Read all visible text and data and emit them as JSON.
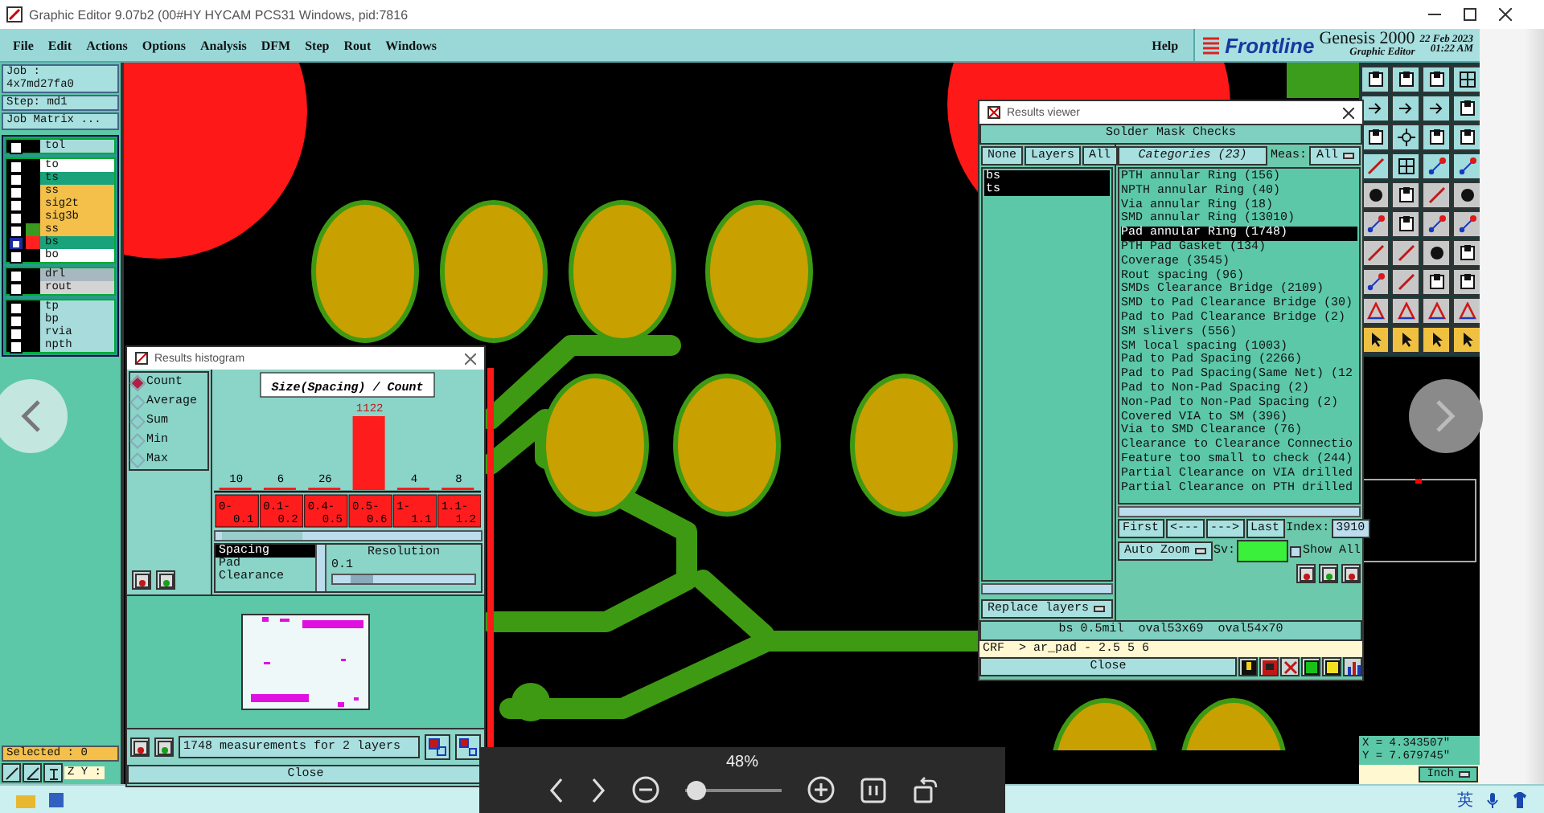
{
  "window": {
    "title": "Graphic Editor 9.07b2 (00#HY HYCAM PCS31  Windows, pid:7816"
  },
  "menu": [
    "File",
    "Edit",
    "Actions",
    "Options",
    "Analysis",
    "DFM",
    "Step",
    "Rout",
    "Windows"
  ],
  "help": "Help",
  "brand": {
    "logo": "Frontline",
    "product": "Genesis 2000",
    "subtitle": "Graphic Editor",
    "date": "22 Feb 2023",
    "time": "01:22 AM"
  },
  "job": {
    "job": "Job : 4x7md27fa0",
    "step": "Step: md1",
    "matrix": "Job Matrix ..."
  },
  "layer_groups": [
    [
      {
        "name": "tol",
        "color": "#a8dcdc",
        "affected": false
      }
    ],
    [
      {
        "name": "to",
        "color": "#ffffff",
        "affected": false
      },
      {
        "name": "ts",
        "color": "#1aa37a",
        "affected": false
      },
      {
        "name": "ss",
        "color": "#f4c04a",
        "affected": false
      },
      {
        "name": "sig2t",
        "color": "#f4c04a",
        "affected": false
      },
      {
        "name": "sig3b",
        "color": "#f4c04a",
        "affected": false
      },
      {
        "name": "ss",
        "color": "#f4c04a",
        "swatch": {
          "color": "#3a9a20"
        },
        "affected": false
      },
      {
        "name": "bs",
        "color": "#1aa37a",
        "swatch": {
          "color": "#ff2020"
        },
        "affected": true
      },
      {
        "name": "bo",
        "color": "#ffffff",
        "affected": false
      }
    ],
    [
      {
        "name": "drl",
        "color": "#a8b8c0",
        "affected": false
      },
      {
        "name": "rout",
        "color": "#d4d4d4",
        "affected": false
      }
    ],
    [
      {
        "name": "tp",
        "color": "#a8dcdc",
        "affected": false
      },
      {
        "name": "bp",
        "color": "#a8dcdc",
        "affected": false
      },
      {
        "name": "rvia",
        "color": "#a8dcdc",
        "affected": false
      },
      {
        "name": "npth",
        "color": "#a8dcdc",
        "affected": false
      }
    ]
  ],
  "selected_count": "Selected : 0",
  "zoom_label": "Z Y :",
  "histogram": {
    "title": "Results histogram",
    "modes": [
      {
        "label": "Count",
        "selected": true
      },
      {
        "label": "Average",
        "selected": false
      },
      {
        "label": "Sum",
        "selected": false
      },
      {
        "label": "Min",
        "selected": false
      },
      {
        "label": "Max",
        "selected": false
      }
    ],
    "chart_data": {
      "type": "bar",
      "title": "Size(Spacing) / Count",
      "categories": [
        "0-0.1",
        "0.1-0.2",
        "0.4-0.5",
        "0.5-0.6",
        "1-1.1",
        "1.1-1.2"
      ],
      "values": [
        10,
        6,
        26,
        1122,
        4,
        8
      ],
      "data_labels": true
    },
    "measures": [
      {
        "label": "Spacing",
        "selected": true
      },
      {
        "label": "Pad",
        "selected": false
      },
      {
        "label": "Clearance",
        "selected": false
      }
    ],
    "resolution_label": "Resolution",
    "resolution_value": "0.1",
    "resolution": {
      "level": 0.12
    },
    "status": "1748 measurements for 2 layers",
    "close": "Close"
  },
  "viewer": {
    "title": "Results viewer",
    "header": "Solder Mask Checks",
    "layer_buttons": [
      "None",
      "Layers",
      "All"
    ],
    "layers": [
      {
        "name": "bs",
        "selected": true
      },
      {
        "name": "ts",
        "selected": true
      }
    ],
    "categories_button": "Categories (23)",
    "meas_label": "Meas:",
    "meas_value": "All",
    "categories": [
      {
        "label": "PTH annular Ring (156)",
        "selected": false
      },
      {
        "label": "NPTH annular Ring (40)",
        "selected": false
      },
      {
        "label": "Via annular Ring (18)",
        "selected": false
      },
      {
        "label": "SMD annular Ring (13010)",
        "selected": false
      },
      {
        "label": "Pad annular Ring (1748)",
        "selected": true
      },
      {
        "label": "PTH Pad Gasket (134)",
        "selected": false
      },
      {
        "label": "Coverage (3545)",
        "selected": false
      },
      {
        "label": "Rout spacing (96)",
        "selected": false
      },
      {
        "label": "SMDs Clearance Bridge (2109)",
        "selected": false
      },
      {
        "label": "SMD to Pad Clearance Bridge (30)",
        "selected": false
      },
      {
        "label": "Pad to Pad Clearance Bridge (2)",
        "selected": false
      },
      {
        "label": "SM slivers (556)",
        "selected": false
      },
      {
        "label": "SM local spacing (1003)",
        "selected": false
      },
      {
        "label": "Pad to Pad Spacing (2266)",
        "selected": false
      },
      {
        "label": "Pad to Pad Spacing(Same Net) (12",
        "selected": false
      },
      {
        "label": "Pad to Non-Pad Spacing (2)",
        "selected": false
      },
      {
        "label": "Non-Pad to Non-Pad Spacing (2)",
        "selected": false
      },
      {
        "label": "Covered VIA to SM (396)",
        "selected": false
      },
      {
        "label": "Via to SMD Clearance (76)",
        "selected": false
      },
      {
        "label": "Clearance to Clearance Connectio",
        "selected": false
      },
      {
        "label": "Feature too small to check (244)",
        "selected": false
      },
      {
        "label": "Partial Clearance on VIA drilled",
        "selected": false
      },
      {
        "label": "Partial Clearance on PTH drilled",
        "selected": false
      }
    ],
    "nav": [
      "First",
      "<---",
      "--->",
      "Last"
    ],
    "index_label": "Index:",
    "index_value": "3910",
    "auto_zoom": "Auto Zoom",
    "sv_label": "Sv:",
    "show_all": {
      "label": "Show All",
      "checked": false
    },
    "replace_layers": "Replace layers",
    "info": "bs 0.5mil  oval53x69  oval54x70",
    "command": "CRF  > ar_pad - 2.5 5 6",
    "close": "Close"
  },
  "coords": {
    "x": "X = 4.343507\"",
    "y": "Y = 7.679745\"",
    "unit": "Inch"
  },
  "image_viewer": {
    "zoom": "48%",
    "zoom_slider": {
      "level": 0.12
    }
  },
  "taskbar": {
    "ime": "英"
  }
}
